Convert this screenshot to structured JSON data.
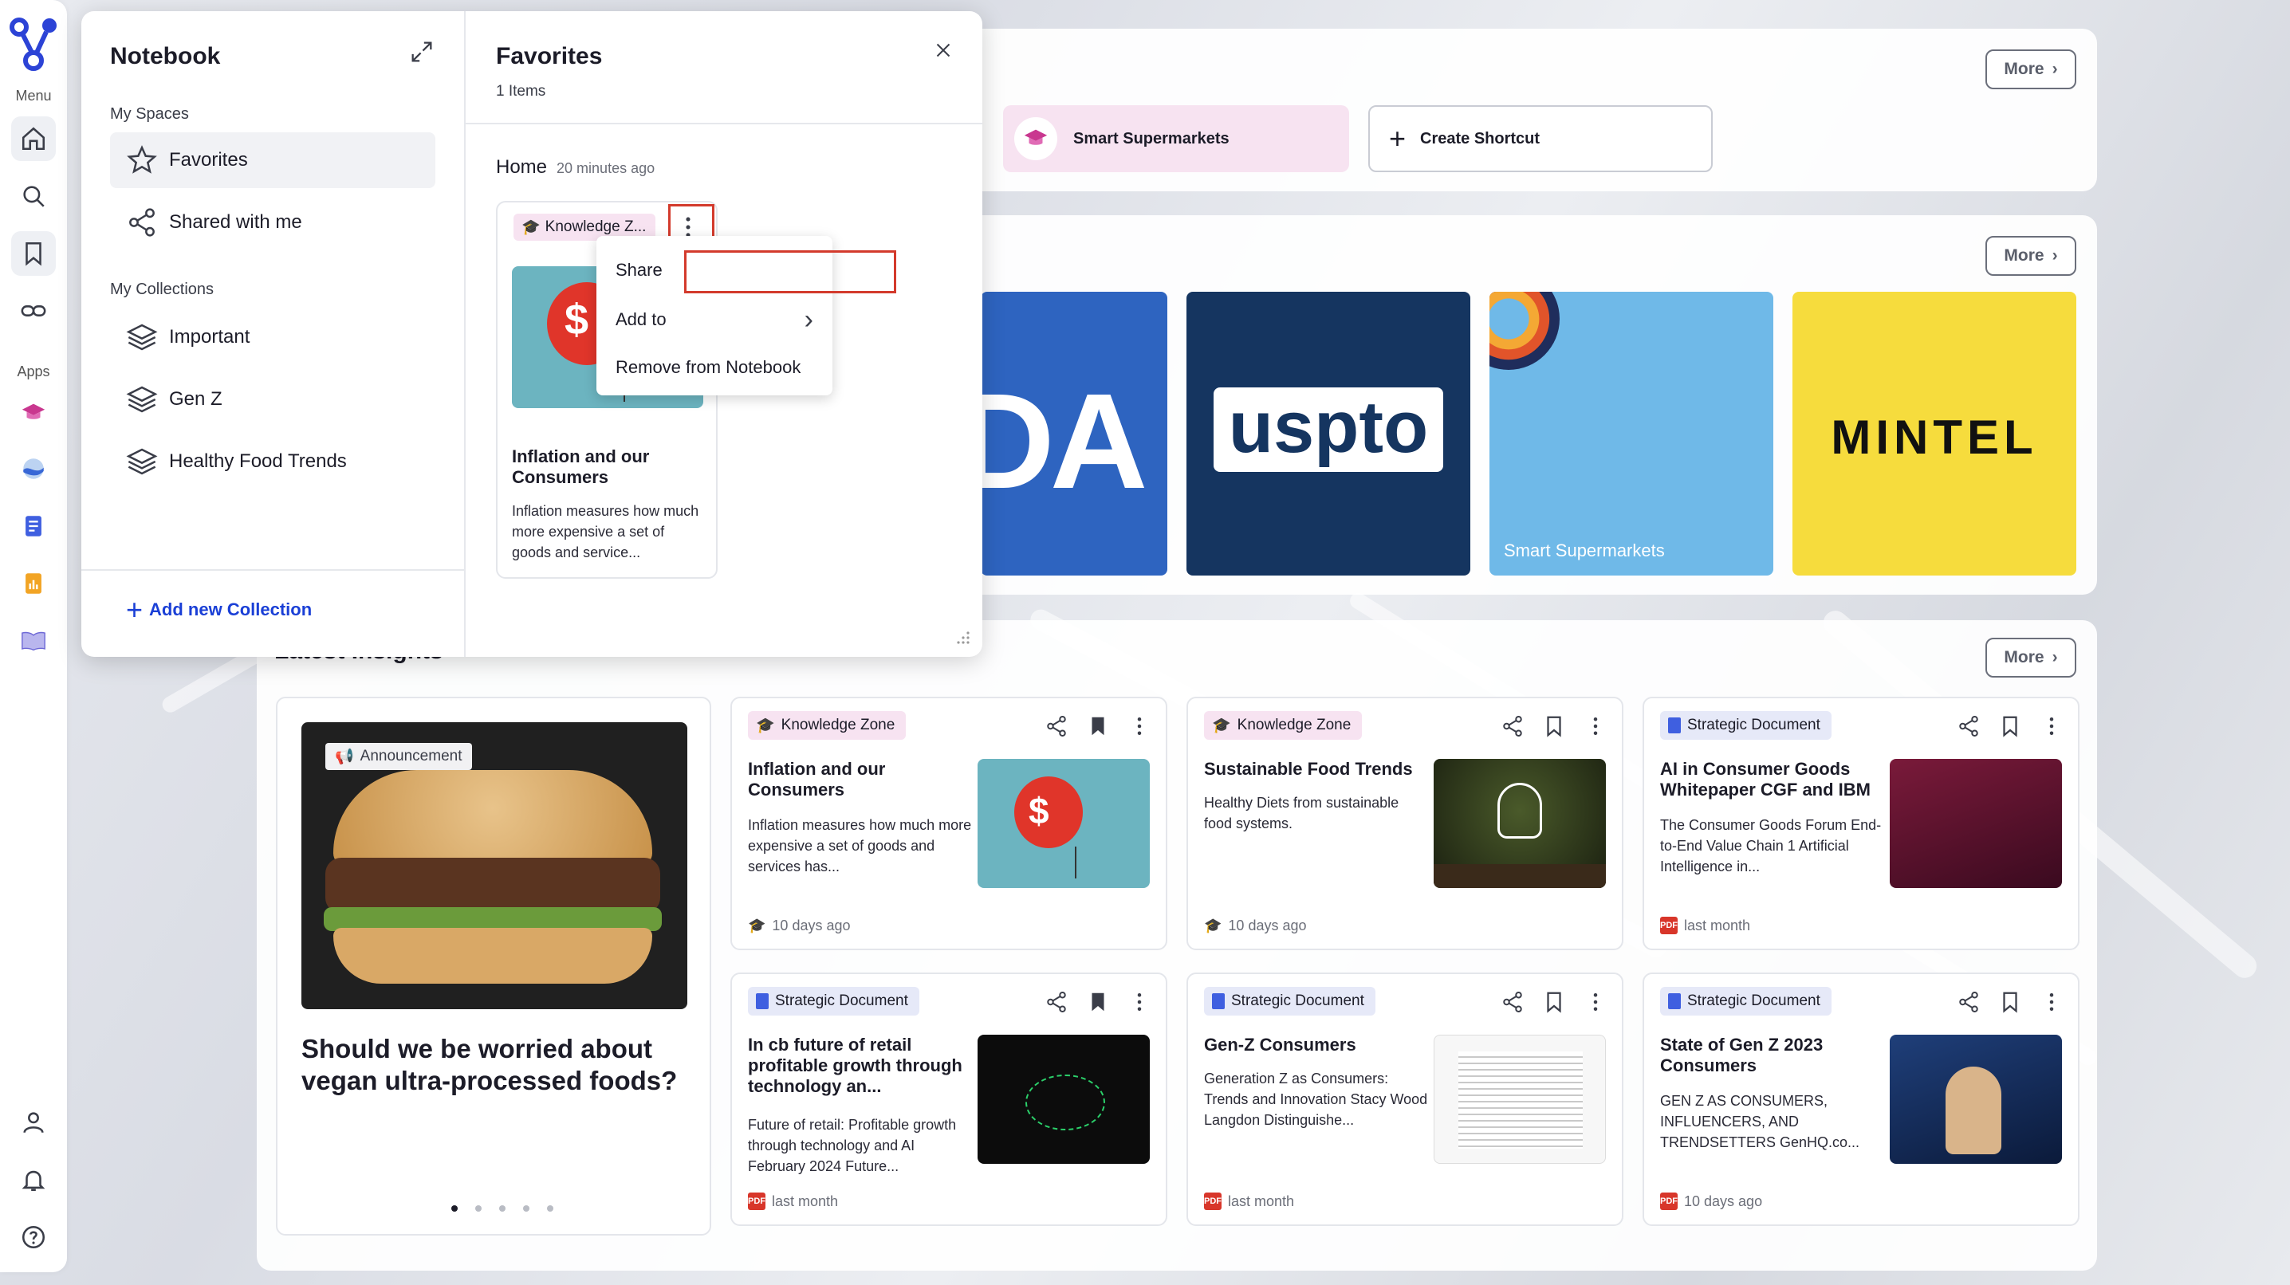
{
  "rail": {
    "menu_label": "Menu",
    "apps_label": "Apps"
  },
  "shortcuts": {
    "more_label": "More",
    "items": [
      {
        "label": "Smart Supermarkets"
      },
      {
        "label": "Create Shortcut"
      }
    ]
  },
  "sources": {
    "more_label": "More",
    "tiles": [
      {
        "label": "DA"
      },
      {
        "label": "uspto"
      },
      {
        "label": "Smart Supermarkets"
      },
      {
        "label": "MINTEL"
      }
    ]
  },
  "insights": {
    "heading": "Latest Insights",
    "more_label": "More",
    "announcement": {
      "badge": "Announcement",
      "title": "Should we be worried about vegan ultra-processed foods?"
    },
    "cards": [
      {
        "tag": "Knowledge Zone",
        "title": "Inflation and our Consumers",
        "desc": "Inflation measures how much more expensive a set of goods and services has...",
        "time": "10 days ago"
      },
      {
        "tag": "Knowledge Zone",
        "title": "Sustainable Food Trends",
        "desc": "Healthy Diets from sustainable food systems.",
        "time": "10 days ago"
      },
      {
        "tag": "Strategic Document",
        "title": "AI in Consumer Goods Whitepaper CGF and IBM",
        "desc": "The Consumer Goods Forum End-to-End Value Chain 1 Artificial Intelligence in...",
        "time": "last month"
      },
      {
        "tag": "Strategic Document",
        "title": "In cb future of retail profitable growth through technology an...",
        "desc": "Future of retail: Profitable growth through technology and AI February 2024 Future...",
        "time": "last month"
      },
      {
        "tag": "Strategic Document",
        "title": "Gen-Z Consumers",
        "desc": "Generation Z as Consumers: Trends and Innovation Stacy Wood Langdon Distinguishe...",
        "time": "last month"
      },
      {
        "tag": "Strategic Document",
        "title": "State of Gen Z 2023 Consumers",
        "desc": "GEN Z AS CONSUMERS, INFLUENCERS, AND TRENDSETTERS GenHQ.co...",
        "time": "10 days ago"
      }
    ]
  },
  "notebook": {
    "title": "Notebook",
    "my_spaces": "My Spaces",
    "spaces": [
      "Favorites",
      "Shared with me"
    ],
    "my_collections": "My Collections",
    "collections": [
      "Important",
      "Gen Z",
      "Healthy Food Trends"
    ],
    "add_collection": "Add new Collection",
    "favorites": {
      "title": "Favorites",
      "count": "1 Items",
      "group": "Home",
      "group_time": "20 minutes ago",
      "card": {
        "tag": "Knowledge Z...",
        "title": "Inflation and our Consumers",
        "desc": "Inflation measures how much more expensive a set of goods and service..."
      }
    },
    "menu": [
      "Share",
      "Add to",
      "Remove from Notebook"
    ]
  },
  "colors": {
    "accent": "#1a3fd6",
    "highlight_box": "#d33a2c",
    "kz_tag": "#f7e3f1",
    "sd_tag": "#e6e9f8"
  }
}
